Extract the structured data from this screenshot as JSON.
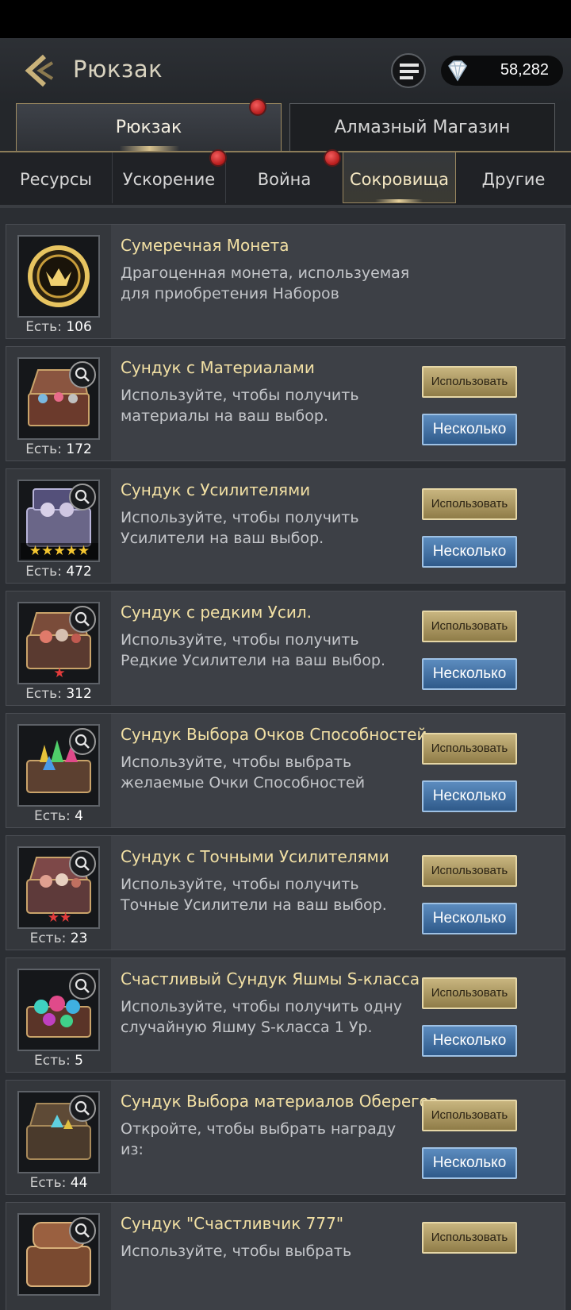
{
  "header": {
    "title": "Рюкзак",
    "diamonds": "58,282"
  },
  "main_tabs": [
    {
      "label": "Рюкзак",
      "active": true,
      "dot": true
    },
    {
      "label": "Алмазный Магазин",
      "active": false,
      "dot": false
    }
  ],
  "sub_tabs": [
    {
      "label": "Ресурсы"
    },
    {
      "label": "Ускорение"
    },
    {
      "label": "Война"
    },
    {
      "label": "Сокровища"
    },
    {
      "label": "Другие"
    }
  ],
  "labels": {
    "have": "Есть:",
    "use": "Использовать",
    "multi": "Несколько"
  },
  "items": [
    {
      "name": "Сумеречная Монета",
      "desc1": "Драгоценная монета, используемая",
      "desc2": "для приобретения Наборов",
      "count": "106",
      "stars": "",
      "icon": "twilight-coin-icon"
    },
    {
      "name": "Сундук с Материалами",
      "desc1": "Используйте, чтобы получить",
      "desc2": "материалы на ваш выбор.",
      "count": "172",
      "stars": "",
      "icon": "materials-chest-icon"
    },
    {
      "name": "Сундук с Усилителями",
      "desc1": "Используйте, чтобы получить",
      "desc2": "Усилители на ваш выбор.",
      "count": "472",
      "stars": "★★★★★",
      "icon": "boosters-chest-icon"
    },
    {
      "name": "Сундук с редким Усил.",
      "desc1": "Используйте, чтобы получить",
      "desc2": "Редкие Усилители на ваш выбор.",
      "count": "312",
      "stars": "★",
      "icon": "rare-boosters-chest-icon"
    },
    {
      "name": "Сундук Выбора Очков Способностей",
      "desc1": "Используйте, чтобы выбрать",
      "desc2": "желаемые Очки Способностей",
      "count": "4",
      "stars": "",
      "icon": "ability-points-chest-icon"
    },
    {
      "name": "Сундук с Точными Усилителями",
      "desc1": "Используйте, чтобы получить",
      "desc2": "Точные Усилители на ваш выбор.",
      "count": "23",
      "stars": "★★",
      "icon": "precise-boosters-chest-icon"
    },
    {
      "name": "Счастливый Сундук Яшмы S-класса",
      "desc1": "Используйте, чтобы получить одну",
      "desc2": "случайную Яшму S-класса 1 Ур.",
      "count": "5",
      "stars": "",
      "icon": "jasper-chest-icon"
    },
    {
      "name": "Сундук Выбора материалов Оберегов",
      "desc1": "Откройте, чтобы выбрать награду",
      "desc2": "из:",
      "count": "44",
      "stars": "",
      "icon": "amulet-materials-chest-icon"
    },
    {
      "name": "Сундук \"Счастливчик 777\"",
      "desc1": "Используйте, чтобы выбрать",
      "desc2": "",
      "count": "",
      "stars": "",
      "icon": "lucky-777-chest-icon"
    }
  ]
}
